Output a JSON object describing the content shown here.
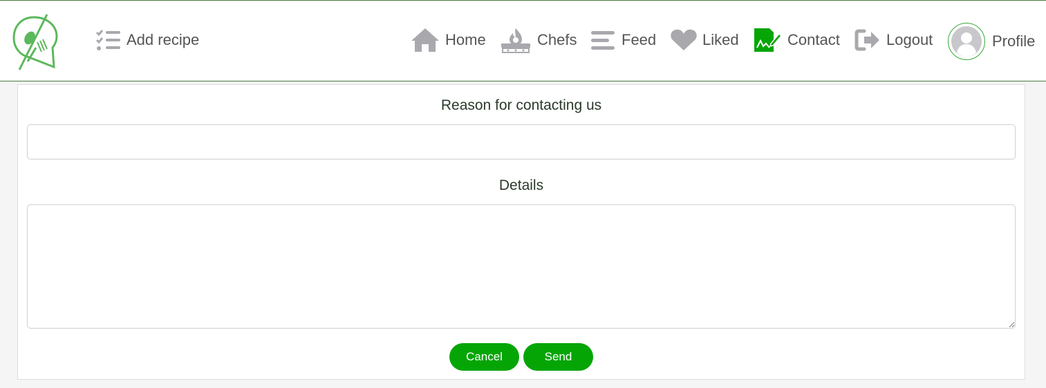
{
  "nav": {
    "add_recipe": "Add recipe",
    "home": "Home",
    "chefs": "Chefs",
    "feed": "Feed",
    "liked": "Liked",
    "contact": "Contact",
    "logout": "Logout",
    "profile": "Profile"
  },
  "icons": {
    "logo": "logo-icon",
    "add_recipe": "checklist-icon",
    "home": "home-icon",
    "chefs": "stove-icon",
    "feed": "menu-lines-icon",
    "liked": "heart-icon",
    "contact": "contact-form-icon",
    "logout": "logout-icon",
    "profile": "user-avatar-icon"
  },
  "form": {
    "reason_label": "Reason for contacting us",
    "reason_value": "",
    "details_label": "Details",
    "details_value": "",
    "cancel_label": "Cancel",
    "send_label": "Send"
  },
  "colors": {
    "accent_green": "#06a506",
    "logo_green": "#5cb85c",
    "nav_icon_gray": "#a8a8ad",
    "nav_text": "#555555"
  }
}
